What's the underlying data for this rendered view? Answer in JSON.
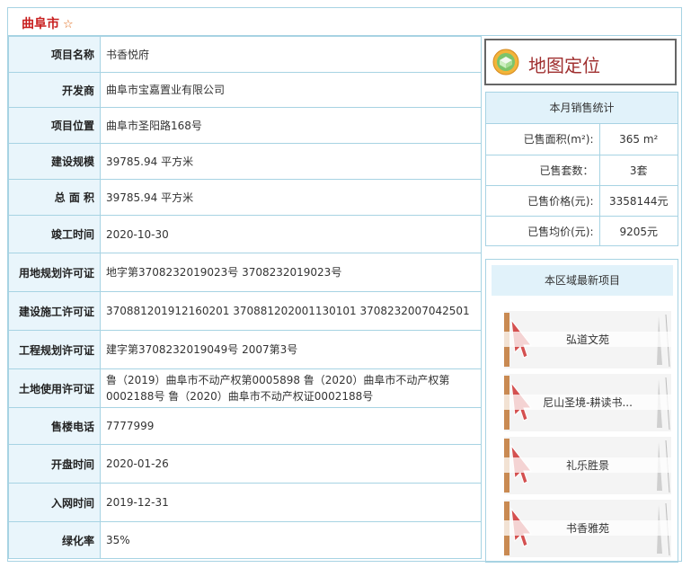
{
  "header": {
    "title": "曲阜市",
    "star": "☆"
  },
  "info_rows": [
    {
      "label": "项目名称",
      "value": "书香悦府"
    },
    {
      "label": "开发商",
      "value": "曲阜市宝嘉置业有限公司"
    },
    {
      "label": "项目位置",
      "value": "曲阜市圣阳路168号"
    },
    {
      "label": "建设规模",
      "value": "39785.94 平方米"
    },
    {
      "label": "总 面 积",
      "value": "39785.94 平方米"
    },
    {
      "label": "竣工时间",
      "value": "2020-10-30"
    },
    {
      "label": "用地规划许可证",
      "value": "地字第3708232019023号 3708232019023号"
    },
    {
      "label": "建设施工许可证",
      "value": "370881201912160201 370881202001130101 3708232007042501"
    },
    {
      "label": "工程规划许可证",
      "value": "建字第3708232019049号 2007第3号"
    },
    {
      "label": "土地使用许可证",
      "value": "鲁（2019）曲阜市不动产权第0005898 鲁（2020）曲阜市不动产权第0002188号 鲁（2020）曲阜市不动产权证0002188号"
    },
    {
      "label": "售楼电话",
      "value": "7777999"
    },
    {
      "label": "开盘时间",
      "value": "2020-01-26"
    },
    {
      "label": "入网时间",
      "value": "2019-12-31"
    },
    {
      "label": "绿化率",
      "value": "35%"
    }
  ],
  "map_button": {
    "label": "地图定位",
    "icon": "map-pin-icon"
  },
  "sales_stats": {
    "title": "本月销售统计",
    "rows": [
      {
        "label": "已售面积(m²):",
        "value": "365 m²"
      },
      {
        "label": "已售套数：",
        "value": "3套"
      },
      {
        "label": "已售价格(元):",
        "value": "3358144元"
      },
      {
        "label": "已售均价(元):",
        "value": "9205元"
      }
    ]
  },
  "nearby": {
    "title": "本区域最新项目",
    "projects": [
      {
        "name": "弘道文苑"
      },
      {
        "name": "尼山圣境-耕读书..."
      },
      {
        "name": "礼乐胜景"
      },
      {
        "name": "书香雅苑"
      }
    ]
  },
  "colors": {
    "border": "#a7d3e3",
    "label_bg": "#e9f5fb",
    "title": "#c81e1e",
    "map_label": "#a03030"
  }
}
